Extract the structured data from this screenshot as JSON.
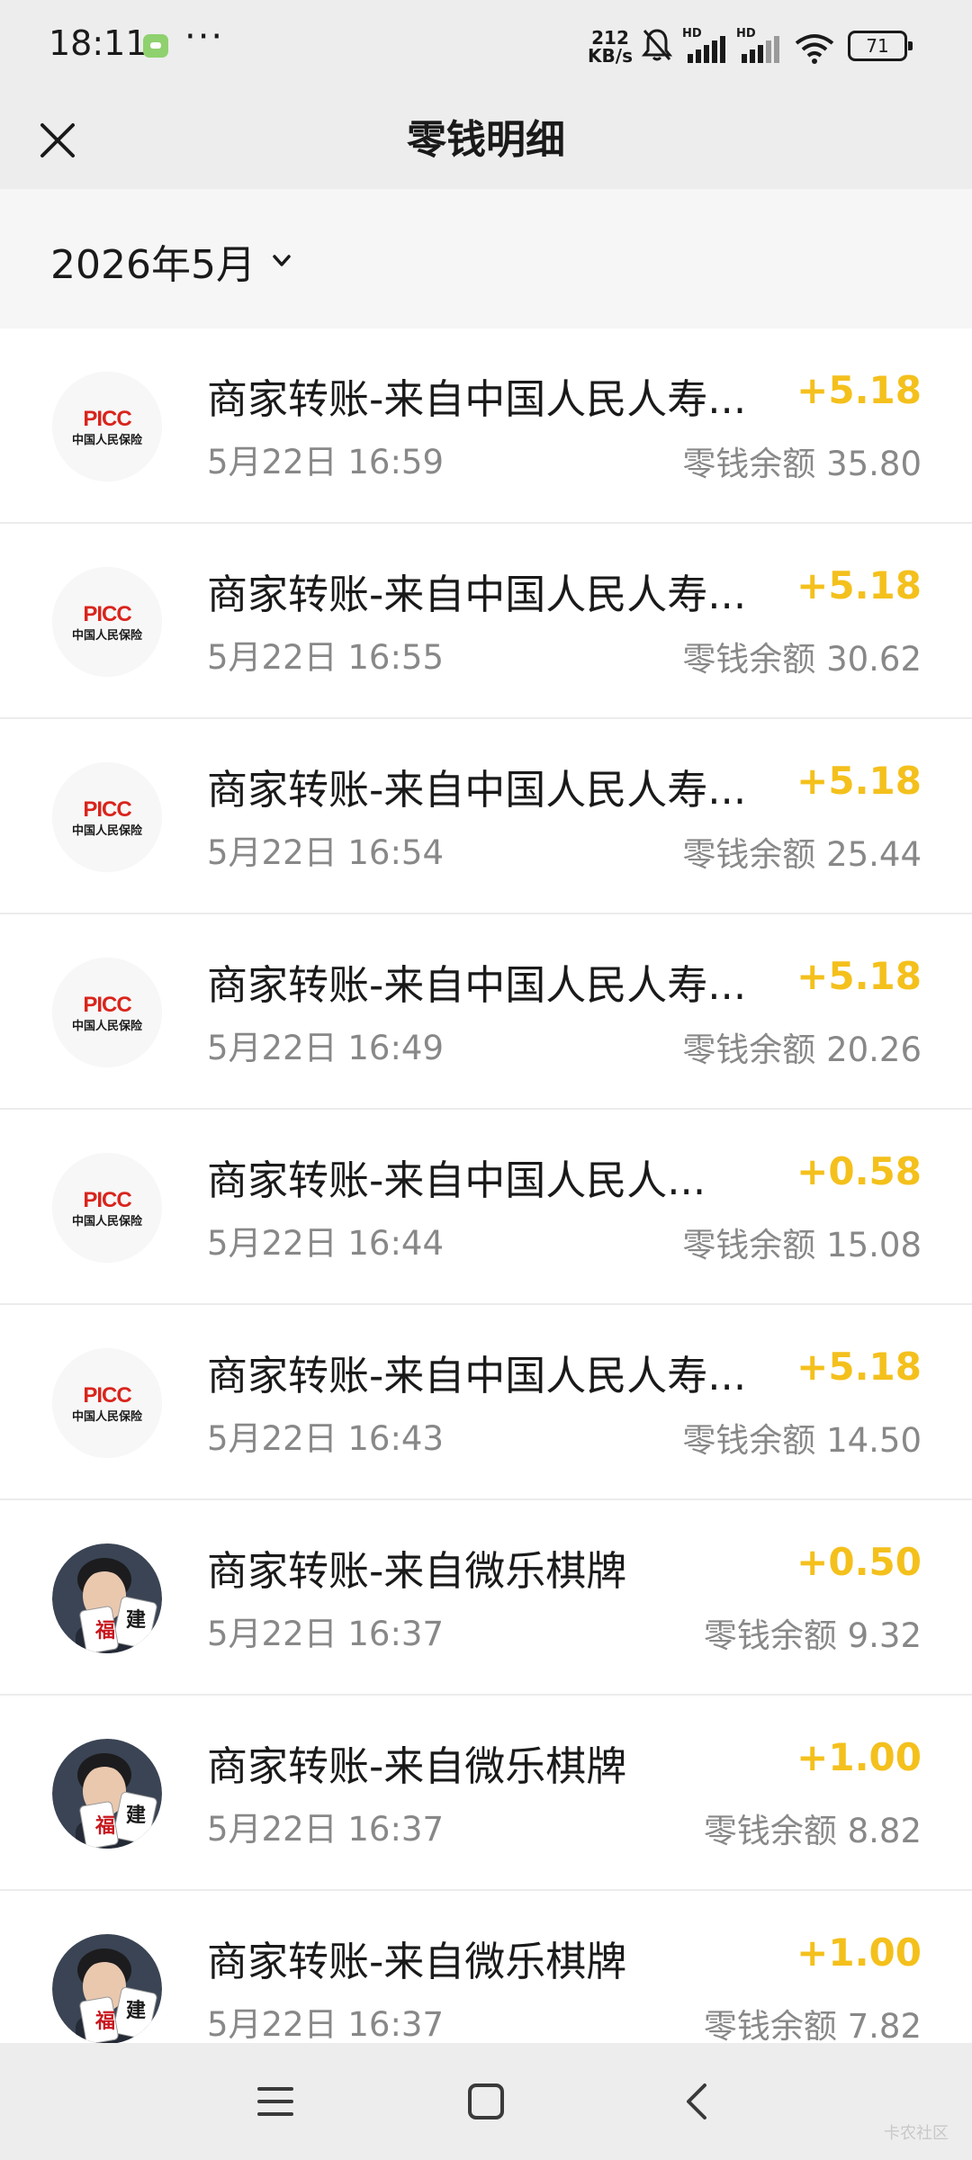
{
  "status_bar": {
    "time": "18:11",
    "dots": "···",
    "net_speed_value": "212",
    "net_speed_unit": "KB/s",
    "hd1": "HD",
    "hd2": "HD",
    "battery": "71"
  },
  "nav": {
    "title": "零钱明细",
    "close_icon": "close-icon"
  },
  "filter": {
    "month": "2026年5月",
    "icon": "chevron-down-icon"
  },
  "transactions": [
    {
      "avatar": "picc-logo",
      "title": "商家转账-来自中国人民人寿...",
      "time": "5月22日 16:59",
      "amount": "+5.18",
      "balance": "零钱余额 35.80"
    },
    {
      "avatar": "picc-logo",
      "title": "商家转账-来自中国人民人寿...",
      "time": "5月22日 16:55",
      "amount": "+5.18",
      "balance": "零钱余额 30.62"
    },
    {
      "avatar": "picc-logo",
      "title": "商家转账-来自中国人民人寿...",
      "time": "5月22日 16:54",
      "amount": "+5.18",
      "balance": "零钱余额 25.44"
    },
    {
      "avatar": "picc-logo",
      "title": "商家转账-来自中国人民人寿...",
      "time": "5月22日 16:49",
      "amount": "+5.18",
      "balance": "零钱余额 20.26"
    },
    {
      "avatar": "picc-logo",
      "title": "商家转账-来自中国人民人...",
      "time": "5月22日 16:44",
      "amount": "+0.58",
      "balance": "零钱余额 15.08"
    },
    {
      "avatar": "picc-logo",
      "title": "商家转账-来自中国人民人寿...",
      "time": "5月22日 16:43",
      "amount": "+5.18",
      "balance": "零钱余额 14.50"
    },
    {
      "avatar": "weile-avatar",
      "title": "商家转账-来自微乐棋牌",
      "time": "5月22日 16:37",
      "amount": "+0.50",
      "balance": "零钱余额 9.32"
    },
    {
      "avatar": "weile-avatar",
      "title": "商家转账-来自微乐棋牌",
      "time": "5月22日 16:37",
      "amount": "+1.00",
      "balance": "零钱余额 8.82"
    },
    {
      "avatar": "weile-avatar",
      "title": "商家转账-来自微乐棋牌",
      "time": "5月22日 16:37",
      "amount": "+1.00",
      "balance": "零钱余额 7.82"
    }
  ],
  "logos": {
    "picc_mark": "PICC",
    "picc_name": "中国人民保险",
    "weile_card1": "福",
    "weile_card2": "建"
  },
  "system_nav": {
    "menu": "menu-icon",
    "home": "home-icon",
    "back": "back-icon"
  },
  "watermark": "卡农社区",
  "colors": {
    "amount": "#f4c01c",
    "header_bg": "#ededed",
    "secondary_text": "#888888"
  }
}
